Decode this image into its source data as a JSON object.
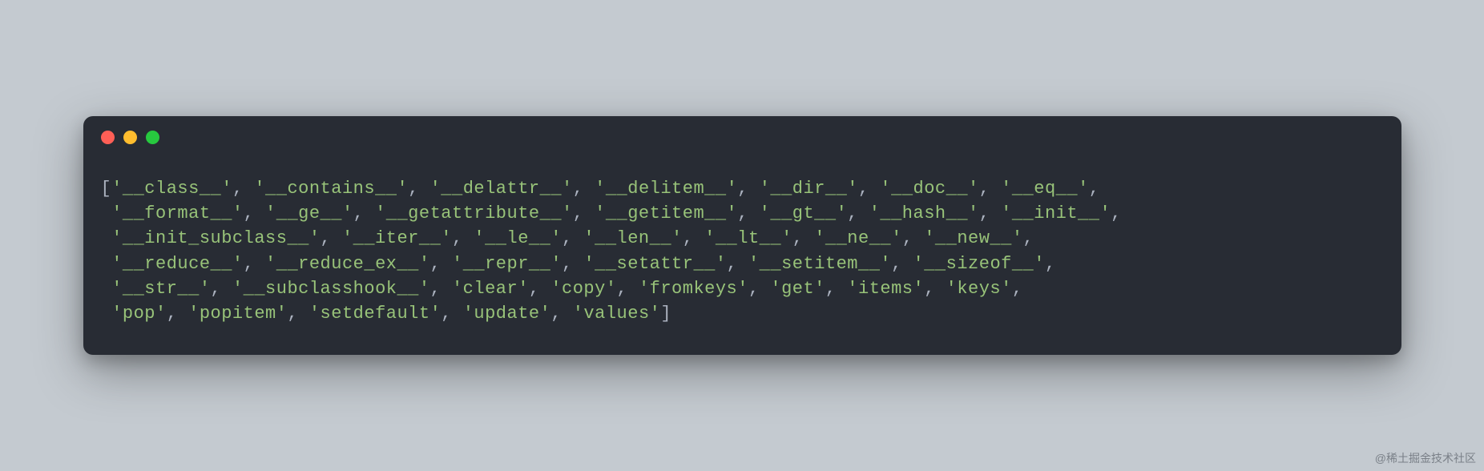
{
  "terminal": {
    "output": {
      "items": [
        "__class__",
        "__contains__",
        "__delattr__",
        "__delitem__",
        "__dir__",
        "__doc__",
        "__eq__",
        "__format__",
        "__ge__",
        "__getattribute__",
        "__getitem__",
        "__gt__",
        "__hash__",
        "__init__",
        "__init_subclass__",
        "__iter__",
        "__le__",
        "__len__",
        "__lt__",
        "__ne__",
        "__new__",
        "__reduce__",
        "__reduce_ex__",
        "__repr__",
        "__setattr__",
        "__setitem__",
        "__sizeof__",
        "__str__",
        "__subclasshook__",
        "clear",
        "copy",
        "fromkeys",
        "get",
        "items",
        "keys",
        "pop",
        "popitem",
        "setdefault",
        "update",
        "values"
      ],
      "line_breaks_after": [
        6,
        13,
        20,
        26,
        34
      ]
    }
  },
  "watermark": "@稀土掘金技术社区"
}
